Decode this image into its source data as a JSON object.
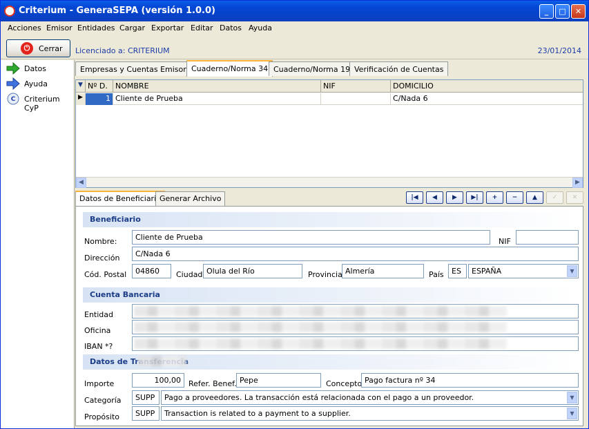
{
  "window": {
    "title": "Criterium - GeneraSEPA (versión 1.0.0)"
  },
  "menu": [
    "Acciones",
    "Emisor",
    "Entidades",
    "Cargar",
    "Exportar",
    "Editar",
    "Datos",
    "Ayuda"
  ],
  "toolbar": {
    "close_label": "Cerrar",
    "license": "Licenciado a: CRITERIUM",
    "date": "23/01/2014"
  },
  "sidebar": {
    "items": [
      {
        "label": "Datos"
      },
      {
        "label": "Ayuda"
      },
      {
        "label": "Criterium CyP"
      }
    ]
  },
  "tabs": [
    "Empresas y Cuentas Emisoras",
    "Cuaderno/Norma 34",
    "Cuaderno/Norma 19",
    "Verificación de Cuentas"
  ],
  "grid": {
    "columns": [
      "Nº D.",
      "NOMBRE",
      "NIF",
      "DOMICILIO"
    ],
    "rows": [
      {
        "num": "1",
        "nombre": "Cliente de Prueba",
        "nif": "",
        "domicilio": "C/Nada 6"
      }
    ]
  },
  "detail_tabs": [
    "Datos de Beneficiario",
    "Generar Archivo"
  ],
  "sections": {
    "beneficiario": "Beneficiario",
    "cuenta": "Cuenta Bancaria",
    "transferencia": "Datos de Transferencia"
  },
  "beneficiario": {
    "nombre_label": "Nombre:",
    "nombre": "Cliente de Prueba",
    "nif_label": "NIF",
    "nif": "",
    "direccion_label": "Dirección",
    "direccion": "C/Nada 6",
    "cp_label": "Cód. Postal",
    "cp": "04860",
    "ciudad_label": "Ciudad",
    "ciudad": "Olula del Río",
    "provincia_label": "Provincia",
    "provincia": "Almería",
    "pais_label": "País",
    "pais_code": "ES",
    "pais": "ESPAÑA"
  },
  "cuenta": {
    "entidad_label": "Entidad",
    "oficina_label": "Oficina",
    "iban_label": "IBAN *?"
  },
  "transferencia": {
    "importe_label": "Importe",
    "importe": "100,00",
    "refer_label": "Refer. Benef.",
    "refer": "Pepe",
    "concepto_label": "Concepto",
    "concepto": "Pago factura nº 34",
    "categoria_label": "Categoría",
    "categoria_code": "SUPP",
    "categoria": "Pago a proveedores. La transacción está relacionada con el pago a un proveedor.",
    "proposito_label": "Propósito",
    "proposito_code": "SUPP",
    "proposito": "Transaction is related to a payment to a supplier."
  }
}
